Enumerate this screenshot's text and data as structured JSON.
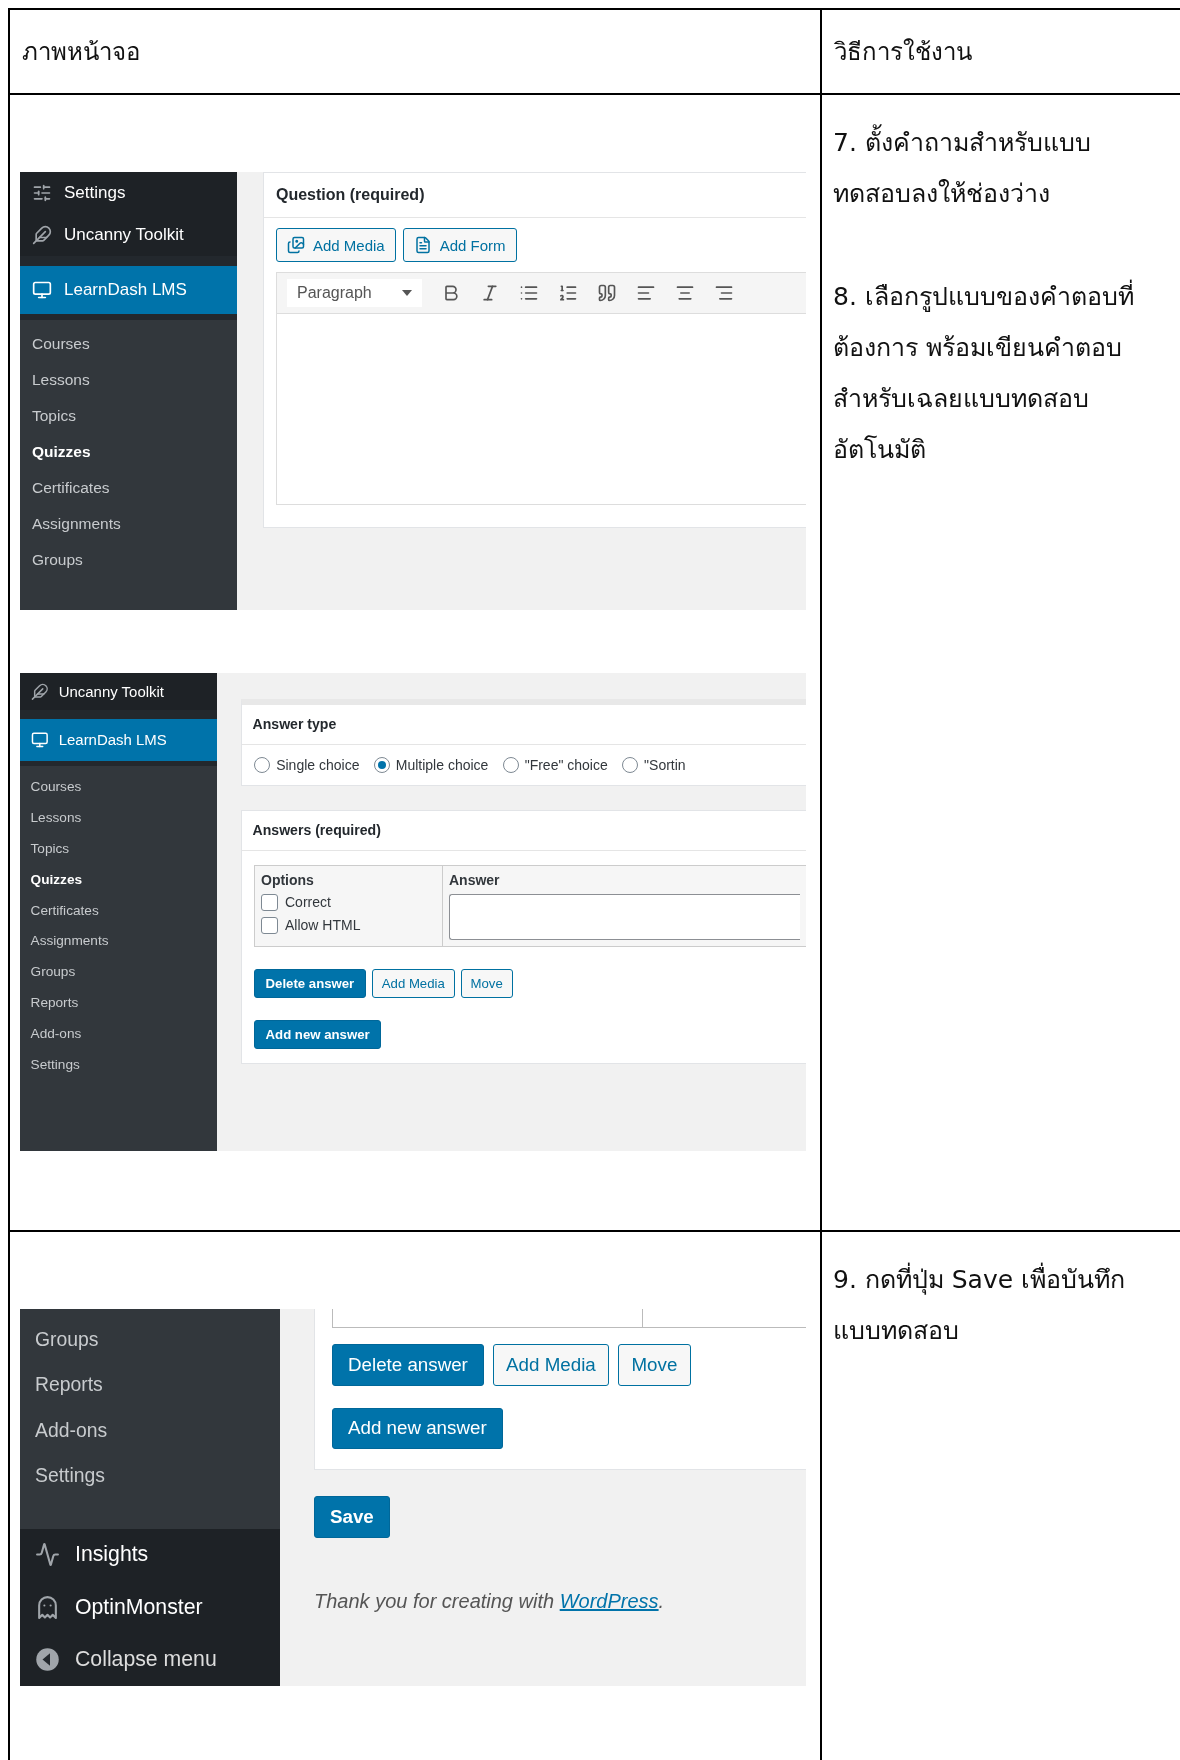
{
  "table": {
    "headers": [
      "ภาพหน้าจอ",
      "วิธีการใช้งาน"
    ],
    "rows": [
      {
        "screenshots": [
          {
            "sidebar": [
              {
                "kind": "settings",
                "label": "Settings"
              },
              {
                "kind": "toolkit",
                "label": "Uncanny Toolkit"
              },
              {
                "kind": "lms",
                "label": "LearnDash LMS"
              },
              {
                "kind": "sub",
                "label": "Courses",
                "selected": false
              },
              {
                "kind": "sub",
                "label": "Lessons",
                "selected": false
              },
              {
                "kind": "sub",
                "label": "Topics",
                "selected": false
              },
              {
                "kind": "sub",
                "label": "Quizzes",
                "selected": true
              },
              {
                "kind": "sub",
                "label": "Certificates",
                "selected": false
              },
              {
                "kind": "sub",
                "label": "Assignments",
                "selected": false
              },
              {
                "kind": "sub",
                "label": "Groups",
                "selected": false
              }
            ],
            "content": {
              "kind": "question_editor",
              "title": "Question (required)",
              "buttons": [
                "Add Media",
                "Add Form"
              ],
              "format": "Paragraph"
            }
          },
          {
            "sidebar": [
              {
                "kind": "toolkit",
                "label": "Uncanny Toolkit"
              },
              {
                "kind": "lms",
                "label": "LearnDash LMS"
              },
              {
                "kind": "sub",
                "label": "Courses",
                "selected": false
              },
              {
                "kind": "sub",
                "label": "Lessons",
                "selected": false
              },
              {
                "kind": "sub",
                "label": "Topics",
                "selected": false
              },
              {
                "kind": "sub",
                "label": "Quizzes",
                "selected": true
              },
              {
                "kind": "sub",
                "label": "Certificates",
                "selected": false
              },
              {
                "kind": "sub",
                "label": "Assignments",
                "selected": false
              },
              {
                "kind": "sub",
                "label": "Groups",
                "selected": false
              },
              {
                "kind": "sub",
                "label": "Reports",
                "selected": false
              },
              {
                "kind": "sub",
                "label": "Add-ons",
                "selected": false
              },
              {
                "kind": "sub",
                "label": "Settings",
                "selected": false
              }
            ],
            "content": {
              "kind": "answer_editor",
              "answer_type": {
                "title": "Answer type",
                "options": [
                  {
                    "label": "Single choice",
                    "selected": false
                  },
                  {
                    "label": "Multiple choice",
                    "selected": true
                  },
                  {
                    "label": "\"Free\" choice",
                    "selected": false
                  },
                  {
                    "label": "\"Sortin",
                    "selected": false
                  }
                ]
              },
              "answers": {
                "title": "Answers (required)",
                "columns": [
                  "Options",
                  "Answer"
                ],
                "checkboxes": [
                  {
                    "label": "Correct",
                    "checked": false
                  },
                  {
                    "label": "Allow HTML",
                    "checked": false
                  }
                ],
                "buttons": [
                  "Delete answer",
                  "Add Media",
                  "Move"
                ],
                "add_button": "Add new answer"
              }
            }
          }
        ],
        "instructions": [
          "7. ตั้งคำถามสำหรับแบบทดสอบลงให้ช่องว่าง",
          "8. เลือกรูปแบบของคำตอบที่ต้องการ พร้อมเขียนคำตอบสำหรับเฉลยแบบทดสอบอัตโนมัติ"
        ]
      },
      {
        "screenshots": [
          {
            "sidebar": [
              {
                "kind": "sub",
                "label": "Groups",
                "selected": false
              },
              {
                "kind": "sub",
                "label": "Reports",
                "selected": false
              },
              {
                "kind": "sub",
                "label": "Add-ons",
                "selected": false
              },
              {
                "kind": "sub",
                "label": "Settings",
                "selected": false
              },
              {
                "kind": "insights",
                "label": "Insights"
              },
              {
                "kind": "monster",
                "label": "OptinMonster"
              },
              {
                "kind": "collapse",
                "label": "Collapse menu"
              }
            ],
            "content": {
              "kind": "save_view",
              "buttons": [
                "Delete answer",
                "Add Media",
                "Move"
              ],
              "add_button": "Add new answer",
              "save_button": "Save",
              "footer": {
                "before": "Thank you for creating with ",
                "link": "WordPress",
                "after": "."
              }
            }
          }
        ],
        "instructions": [
          "9. กดที่ปุ่ม Save เพื่อบันทึกแบบทดสอบ"
        ]
      }
    ]
  }
}
